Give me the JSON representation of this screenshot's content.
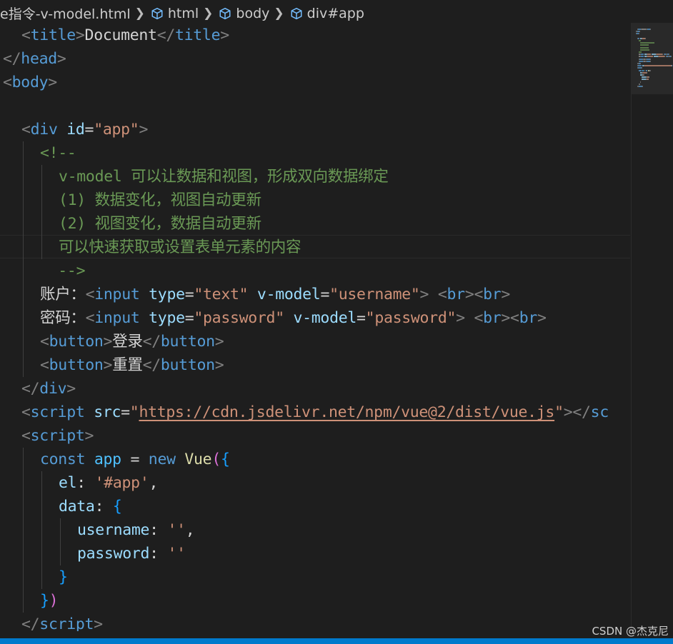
{
  "breadcrumb": {
    "file": "e指令-v-model.html",
    "items": [
      "html",
      "body",
      "div#app"
    ]
  },
  "code": {
    "lines": [
      {
        "indent": 1,
        "tokens": [
          [
            "punc",
            "<"
          ],
          [
            "tag",
            "title"
          ],
          [
            "punc",
            ">"
          ],
          [
            "text",
            "Document"
          ],
          [
            "punc",
            "</"
          ],
          [
            "tag",
            "title"
          ],
          [
            "punc",
            ">"
          ]
        ]
      },
      {
        "indent": 0,
        "tokens": [
          [
            "punc",
            "</"
          ],
          [
            "tag",
            "head"
          ],
          [
            "punc",
            ">"
          ]
        ]
      },
      {
        "indent": 0,
        "tokens": [
          [
            "punc",
            "<"
          ],
          [
            "tag",
            "body"
          ],
          [
            "punc",
            ">"
          ]
        ]
      },
      {
        "indent": 0,
        "tokens": []
      },
      {
        "indent": 1,
        "tokens": [
          [
            "punc",
            "<"
          ],
          [
            "tag",
            "div"
          ],
          [
            "text",
            " "
          ],
          [
            "attr",
            "id"
          ],
          [
            "text",
            "="
          ],
          [
            "str",
            "\"app\""
          ],
          [
            "punc",
            ">"
          ]
        ]
      },
      {
        "indent": 2,
        "tokens": [
          [
            "comment",
            "<!--"
          ]
        ]
      },
      {
        "indent": 3,
        "tokens": [
          [
            "comment",
            "v-model 可以让数据和视图，形成双向数据绑定"
          ]
        ]
      },
      {
        "indent": 3,
        "tokens": [
          [
            "comment",
            "(1) 数据变化，视图自动更新"
          ]
        ]
      },
      {
        "indent": 3,
        "tokens": [
          [
            "comment",
            "(2) 视图变化，数据自动更新"
          ]
        ]
      },
      {
        "indent": 3,
        "tokens": [
          [
            "comment",
            "可以快速获取或设置表单元素的内容"
          ]
        ]
      },
      {
        "indent": 2,
        "tokens": [
          [
            "comment",
            "  -->"
          ]
        ]
      },
      {
        "indent": 2,
        "tokens": [
          [
            "text",
            "账户："
          ],
          [
            "punc",
            "<"
          ],
          [
            "tag",
            "input"
          ],
          [
            "text",
            " "
          ],
          [
            "attr",
            "type"
          ],
          [
            "text",
            "="
          ],
          [
            "str",
            "\"text\""
          ],
          [
            "text",
            " "
          ],
          [
            "attr",
            "v-model"
          ],
          [
            "text",
            "="
          ],
          [
            "str",
            "\"username\""
          ],
          [
            "punc",
            ">"
          ],
          [
            "text",
            " "
          ],
          [
            "punc",
            "<"
          ],
          [
            "tag",
            "br"
          ],
          [
            "punc",
            "><"
          ],
          [
            "tag",
            "br"
          ],
          [
            "punc",
            ">"
          ]
        ]
      },
      {
        "indent": 2,
        "tokens": [
          [
            "text",
            "密码："
          ],
          [
            "punc",
            "<"
          ],
          [
            "tag",
            "input"
          ],
          [
            "text",
            " "
          ],
          [
            "attr",
            "type"
          ],
          [
            "text",
            "="
          ],
          [
            "str",
            "\"password\""
          ],
          [
            "text",
            " "
          ],
          [
            "attr",
            "v-model"
          ],
          [
            "text",
            "="
          ],
          [
            "str",
            "\"password\""
          ],
          [
            "punc",
            ">"
          ],
          [
            "text",
            " "
          ],
          [
            "punc",
            "<"
          ],
          [
            "tag",
            "br"
          ],
          [
            "punc",
            "><"
          ],
          [
            "tag",
            "br"
          ],
          [
            "punc",
            ">"
          ]
        ]
      },
      {
        "indent": 2,
        "tokens": [
          [
            "punc",
            "<"
          ],
          [
            "tag",
            "button"
          ],
          [
            "punc",
            ">"
          ],
          [
            "text",
            "登录"
          ],
          [
            "punc",
            "</"
          ],
          [
            "tag",
            "button"
          ],
          [
            "punc",
            ">"
          ]
        ]
      },
      {
        "indent": 2,
        "tokens": [
          [
            "punc",
            "<"
          ],
          [
            "tag",
            "button"
          ],
          [
            "punc",
            ">"
          ],
          [
            "text",
            "重置"
          ],
          [
            "punc",
            "</"
          ],
          [
            "tag",
            "button"
          ],
          [
            "punc",
            ">"
          ]
        ]
      },
      {
        "indent": 1,
        "tokens": [
          [
            "punc",
            "</"
          ],
          [
            "tag",
            "div"
          ],
          [
            "punc",
            ">"
          ]
        ]
      },
      {
        "indent": 1,
        "tokens": [
          [
            "punc",
            "<"
          ],
          [
            "tag",
            "script"
          ],
          [
            "text",
            " "
          ],
          [
            "attr",
            "src"
          ],
          [
            "text",
            "="
          ],
          [
            "str",
            "\""
          ],
          [
            "link",
            "https://cdn.jsdelivr.net/npm/vue@2/dist/vue.js"
          ],
          [
            "str",
            "\""
          ],
          [
            "punc",
            "></"
          ],
          [
            "tag",
            "sc"
          ]
        ]
      },
      {
        "indent": 1,
        "tokens": [
          [
            "punc",
            "<"
          ],
          [
            "tag",
            "script"
          ],
          [
            "punc",
            ">"
          ]
        ]
      },
      {
        "indent": 2,
        "tokens": [
          [
            "key",
            "const"
          ],
          [
            "text",
            " "
          ],
          [
            "var",
            "app"
          ],
          [
            "text",
            " "
          ],
          [
            "op",
            "="
          ],
          [
            "text",
            " "
          ],
          [
            "key",
            "new"
          ],
          [
            "text",
            " "
          ],
          [
            "fn",
            "Vue"
          ],
          [
            "b1",
            "("
          ],
          [
            "b2",
            "{"
          ]
        ]
      },
      {
        "indent": 3,
        "tokens": [
          [
            "prop",
            "el"
          ],
          [
            "text",
            ": "
          ],
          [
            "str",
            "'#app'"
          ],
          [
            "text",
            ","
          ]
        ]
      },
      {
        "indent": 3,
        "tokens": [
          [
            "prop",
            "data"
          ],
          [
            "text",
            ": "
          ],
          [
            "b2",
            "{"
          ]
        ]
      },
      {
        "indent": 4,
        "tokens": [
          [
            "prop",
            "username"
          ],
          [
            "text",
            ": "
          ],
          [
            "str",
            "''"
          ],
          [
            "text",
            ","
          ]
        ]
      },
      {
        "indent": 4,
        "tokens": [
          [
            "prop",
            "password"
          ],
          [
            "text",
            ": "
          ],
          [
            "str",
            "''"
          ]
        ]
      },
      {
        "indent": 3,
        "tokens": [
          [
            "b2",
            "}"
          ]
        ]
      },
      {
        "indent": 2,
        "tokens": [
          [
            "b2",
            "}"
          ],
          [
            "b1",
            ")"
          ]
        ]
      },
      {
        "indent": 1,
        "tokens": [
          [
            "punc",
            "</"
          ],
          [
            "tag",
            "script"
          ],
          [
            "punc",
            ">"
          ]
        ]
      }
    ]
  },
  "watermark": "CSDN @杰克尼",
  "colors": {
    "background": "#1e1e1e",
    "statusbar": "#007acc",
    "tag": "#569cd6",
    "attribute": "#9cdcfe",
    "string": "#ce9178",
    "comment": "#6a9955"
  }
}
